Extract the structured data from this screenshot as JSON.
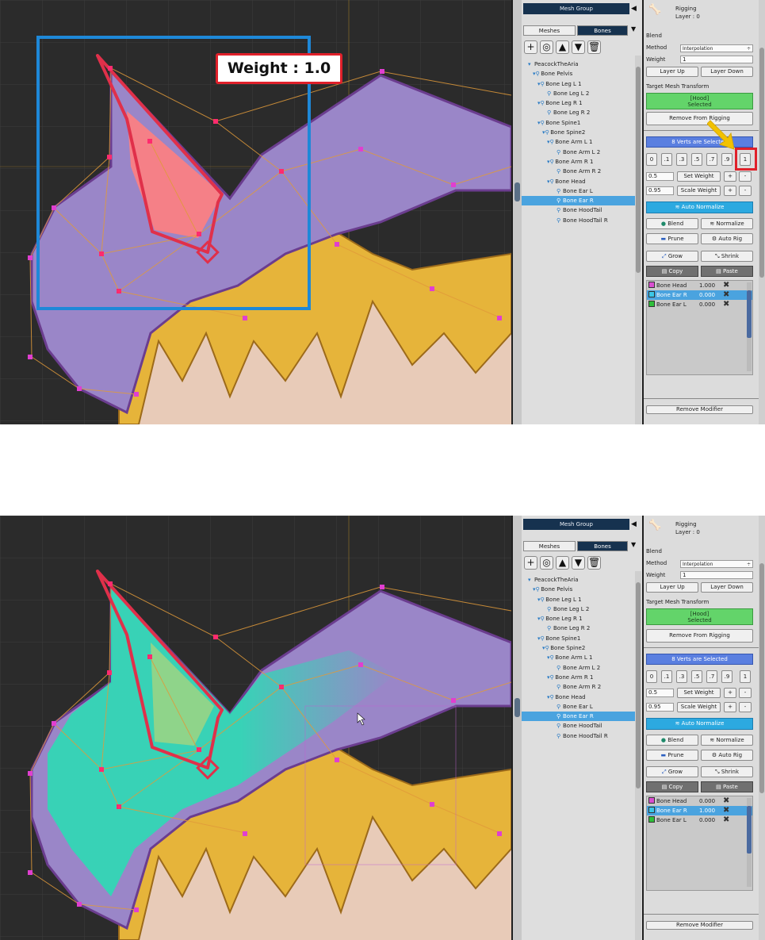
{
  "top": {
    "callout": "Weight : 1.0",
    "weights": [
      "1.000",
      "0.000",
      "0.000"
    ]
  },
  "bottom": {
    "weights": [
      "0.000",
      "1.000",
      "0.000"
    ]
  },
  "hierarchy": {
    "title": "Mesh Group",
    "tabs": [
      "Meshes",
      "Bones"
    ],
    "tree": [
      {
        "label": "PeacockTheAria",
        "indent": 0,
        "kind": "root"
      },
      {
        "label": "Bone Pelvis",
        "indent": 1,
        "kind": "bone-open"
      },
      {
        "label": "Bone Leg L 1",
        "indent": 2,
        "kind": "bone-open"
      },
      {
        "label": "Bone Leg L 2",
        "indent": 3,
        "kind": "bone"
      },
      {
        "label": "Bone Leg R 1",
        "indent": 2,
        "kind": "bone-open"
      },
      {
        "label": "Bone Leg R 2",
        "indent": 3,
        "kind": "bone"
      },
      {
        "label": "Bone Spine1",
        "indent": 2,
        "kind": "bone-open"
      },
      {
        "label": "Bone Spine2",
        "indent": 3,
        "kind": "bone-open"
      },
      {
        "label": "Bone Arm L 1",
        "indent": 4,
        "kind": "bone-open"
      },
      {
        "label": "Bone Arm L 2",
        "indent": 5,
        "kind": "bone"
      },
      {
        "label": "Bone Arm R 1",
        "indent": 4,
        "kind": "bone-open"
      },
      {
        "label": "Bone Arm R 2",
        "indent": 5,
        "kind": "bone"
      },
      {
        "label": "Bone Head",
        "indent": 4,
        "kind": "bone-open"
      },
      {
        "label": "Bone Ear L",
        "indent": 5,
        "kind": "bone"
      },
      {
        "label": "Bone Ear R",
        "indent": 5,
        "kind": "bone",
        "selected": true
      },
      {
        "label": "Bone HoodTail",
        "indent": 5,
        "kind": "bone"
      },
      {
        "label": "Bone HoodTail R",
        "indent": 5,
        "kind": "bone"
      }
    ]
  },
  "inspector": {
    "header_title": "Rigging",
    "header_sub": "Layer : 0",
    "blend_label": "Blend",
    "method_label": "Method",
    "method_value": "Interpolation",
    "weight_label": "Weight",
    "weight_value": "1",
    "layer_up": "Layer Up",
    "layer_down": "Layer Down",
    "target_label": "Target Mesh Transform",
    "target_line1": "[Hood]",
    "target_line2": "Selected",
    "remove_from_rigging": "Remove From Rigging",
    "verts_selected": "8 Verts are Selected",
    "presets": [
      "0",
      ".1",
      ".3",
      ".5",
      ".7",
      ".9",
      "1"
    ],
    "set_weight_value": "0.5",
    "set_weight": "Set Weight",
    "scale_weight_value": "0.95",
    "scale_weight": "Scale Weight",
    "plus": "+",
    "minus": "-",
    "auto_normalize": "Auto Normalize",
    "blend": "Blend",
    "normalize": "Normalize",
    "prune": "Prune",
    "auto_rig": "Auto Rig",
    "grow": "Grow",
    "shrink": "Shrink",
    "copy": "Copy",
    "paste": "Paste",
    "bones": [
      "Bone Head",
      "Bone Ear R",
      "Bone Ear L"
    ],
    "bone_colors": [
      "#d94fd0",
      "#3cc7e6",
      "#2fbf3a"
    ],
    "remove_modifier": "Remove Modifier"
  },
  "colors": {
    "hood_purple": "#9a86c8",
    "ear_teal": "#2fd9b5",
    "bone_red": "#e0304a",
    "highlight_blue": "#1e88d8",
    "hair_yellow": "#e6b43a"
  }
}
